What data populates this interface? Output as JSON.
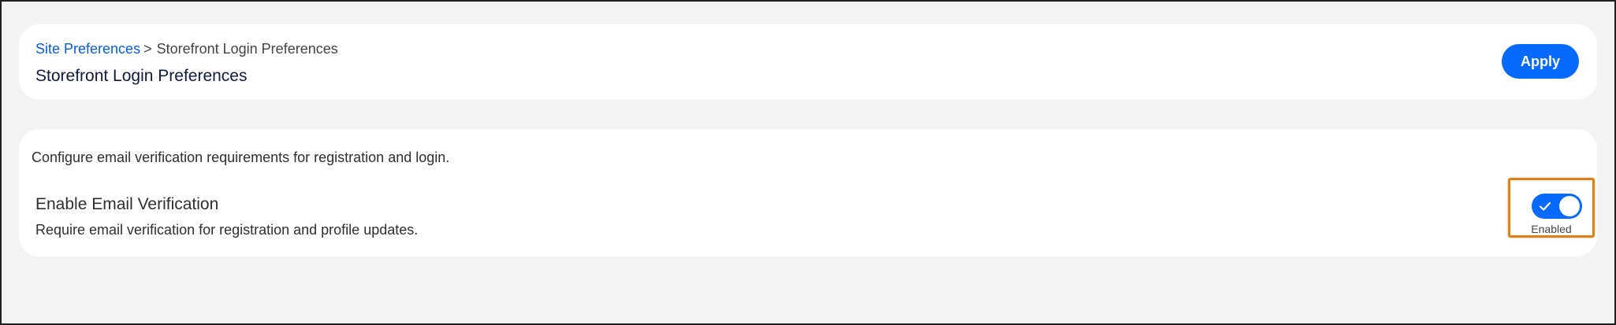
{
  "header": {
    "breadcrumb": {
      "parent_label": "Site Preferences",
      "separator": ">",
      "current_label": "Storefront Login Preferences"
    },
    "title": "Storefront Login Preferences",
    "apply_label": "Apply"
  },
  "settings": {
    "description": "Configure email verification requirements for registration and login.",
    "email_verification": {
      "label": "Enable Email Verification",
      "help_text": "Require email verification for registration and profile updates.",
      "enabled": true,
      "status_label": "Enabled"
    }
  },
  "colors": {
    "accent": "#066afe",
    "link": "#0b5cd5",
    "highlight": "#e07f13"
  },
  "icons": {
    "toggle_check": "check-icon"
  }
}
